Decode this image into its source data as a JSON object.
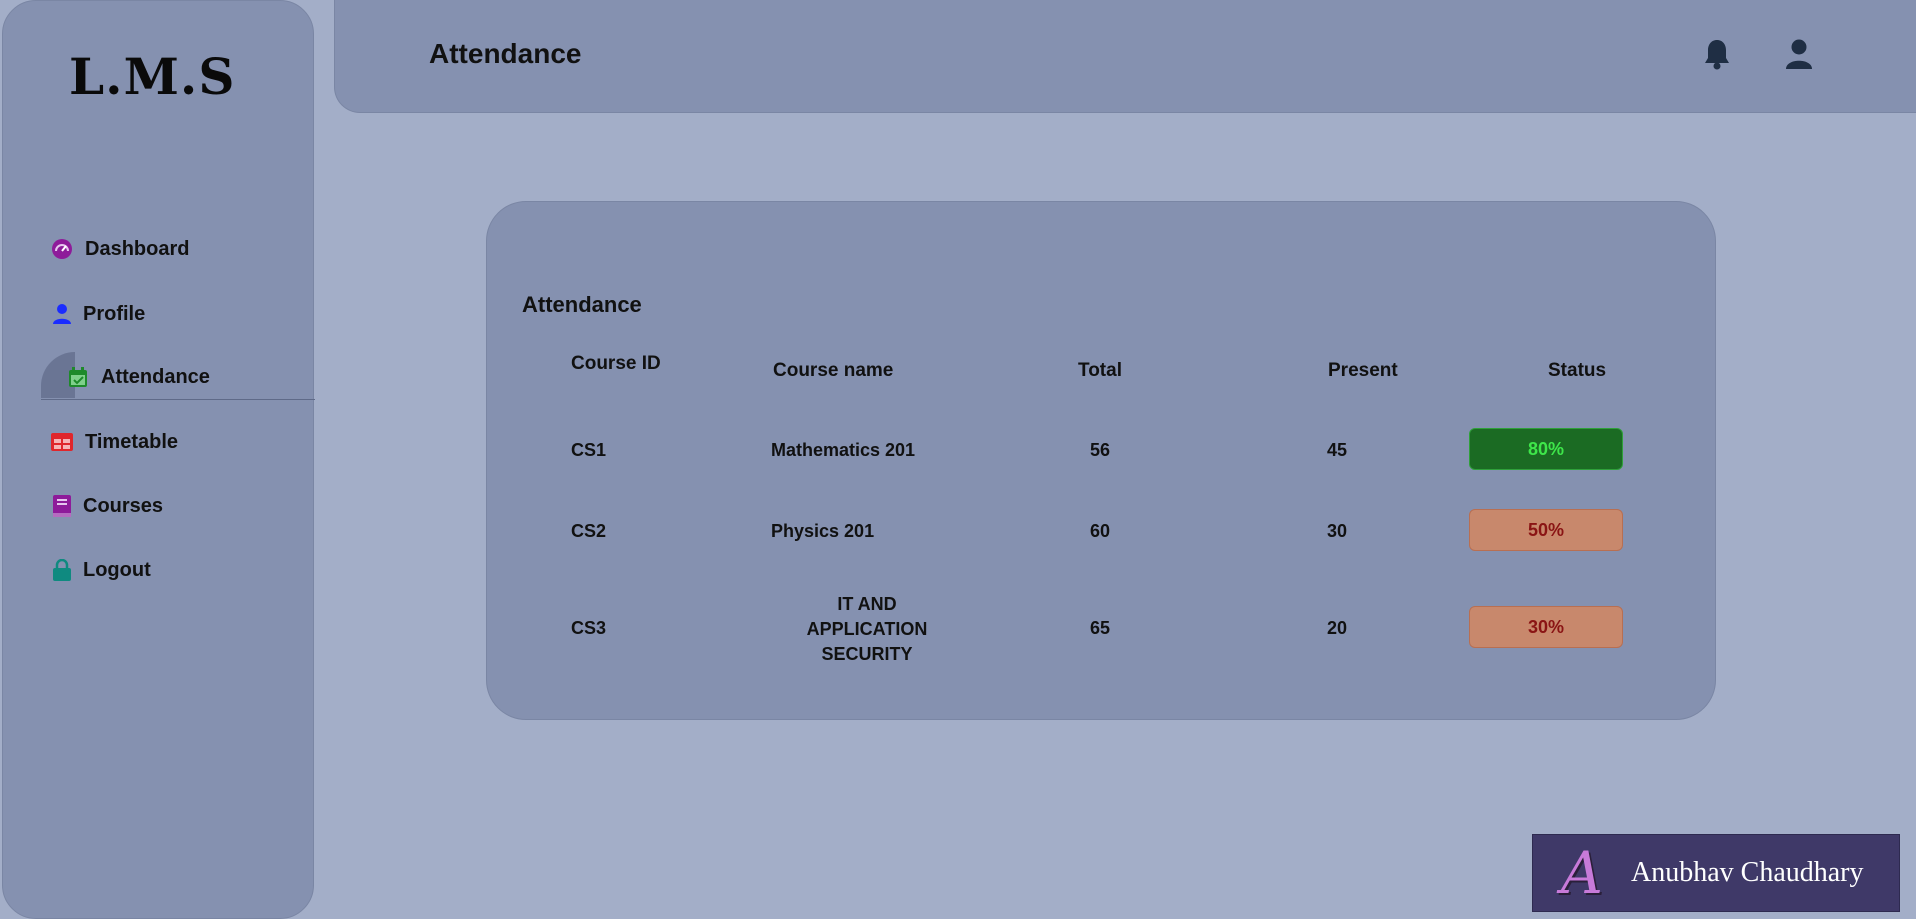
{
  "app": {
    "logo": "L.M.S"
  },
  "sidebar": {
    "items": [
      {
        "label": "Dashboard",
        "icon": "dashboard-gauge-icon",
        "color": "#8e1b9a"
      },
      {
        "label": "Profile",
        "icon": "user-icon",
        "color": "#1a2cff"
      },
      {
        "label": "Attendance",
        "icon": "calendar-check-icon",
        "color": "#1e8a2a",
        "active": true
      },
      {
        "label": "Timetable",
        "icon": "table-icon",
        "color": "#e0262b"
      },
      {
        "label": "Courses",
        "icon": "book-icon",
        "color": "#8e1b9a"
      },
      {
        "label": "Logout",
        "icon": "lock-icon",
        "color": "#0f8a80"
      }
    ]
  },
  "header": {
    "title": "Attendance",
    "icons": [
      "bell-icon",
      "user-icon"
    ],
    "icon_color": "#1f2e44"
  },
  "attendance": {
    "title": "Attendance",
    "columns": [
      "Course ID",
      "Course name",
      "Total",
      "Present",
      "Status"
    ],
    "rows": [
      {
        "id": "CS1",
        "name": "Mathematics 201",
        "total": "56",
        "present": "45",
        "status": "80%",
        "status_level": "good"
      },
      {
        "id": "CS2",
        "name": "Physics 201",
        "total": "60",
        "present": "30",
        "status": "50%",
        "status_level": "low"
      },
      {
        "id": "CS3",
        "name": "IT AND APPLICATION SECURITY",
        "name_lines": [
          "IT AND",
          "APPLICATION",
          "SECURITY"
        ],
        "total": "65",
        "present": "20",
        "status": "30%",
        "status_level": "low"
      }
    ]
  },
  "watermark": {
    "glyph": "A",
    "name": "Anubhav Chaudhary"
  }
}
